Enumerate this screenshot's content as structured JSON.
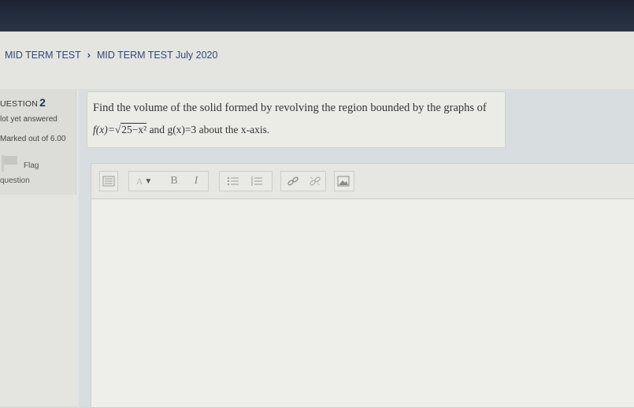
{
  "breadcrumb": {
    "item1": "MID TERM TEST",
    "separator": "›",
    "item2": "MID TERM TEST July 2020"
  },
  "question_info": {
    "label": "UESTION",
    "number": "2",
    "state": "lot yet answered",
    "grade": "Marked out of 6.00",
    "flag_label": "Flag",
    "flag_label2": "question"
  },
  "question": {
    "text": "Find the volume of the solid formed by revolving the region bounded by the graphs of",
    "f_lhs": "f(x)=",
    "sqrt_content": "25−x²",
    "and": " and ",
    "g_expr": "g(x)=3",
    "about": " about the x-axis."
  },
  "toolbar": {
    "bold": "B",
    "italic": "I",
    "font_color": "A"
  },
  "colors": {
    "top_bar": "#1c2434",
    "link": "#2f4a7a",
    "question_bg": "#ecece7"
  }
}
